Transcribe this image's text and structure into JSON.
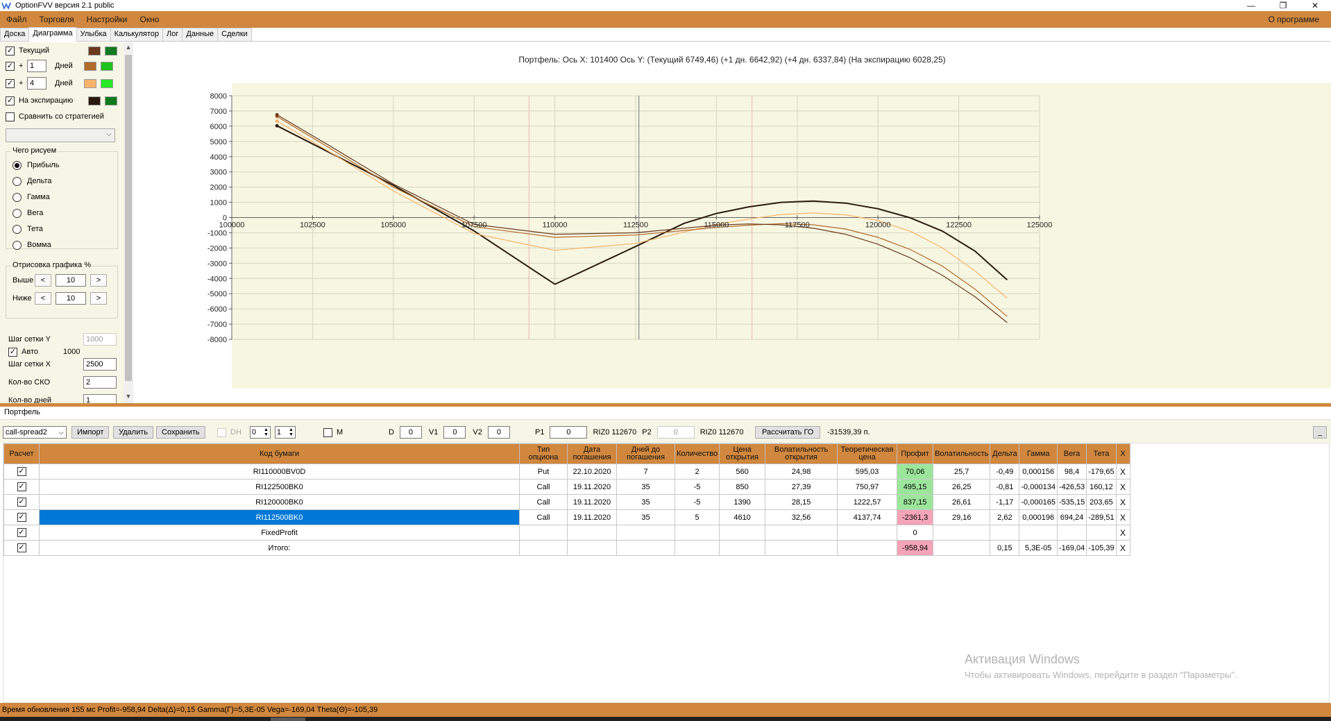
{
  "window": {
    "title": "OptionFVV версия 2.1 public",
    "minimize": "—",
    "restore": "❐",
    "close": "✕"
  },
  "menu": {
    "items": [
      "Файл",
      "Торговля",
      "Настройки",
      "Окно"
    ],
    "about": "О программе"
  },
  "tabs": [
    "Доска",
    "Диаграмма",
    "Улыбка",
    "Калькулятор",
    "Лог",
    "Данные",
    "Сделки"
  ],
  "left_panel": {
    "current_label": "Текущий",
    "plus1_label": "+",
    "plus1_value": "1",
    "days_label": "Дней",
    "plus2_label": "+",
    "plus2_value": "4",
    "days2_label": "Дней",
    "expiry_label": "На экспирацию",
    "compare_label": "Сравнить со стратегией",
    "colors": {
      "current_a": "#6b3a1d",
      "current_b": "#0f7a1e",
      "plus1_a": "#b26a2d",
      "plus1_b": "#1ec21e",
      "plus2_a": "#fbb36b",
      "plus2_b": "#27e827",
      "expiry_a": "#2b1a0e",
      "expiry_b": "#0d7a1a"
    },
    "draw_group": {
      "title": "Чего рисуем",
      "options": [
        "Прибыль",
        "Дельта",
        "Гамма",
        "Вега",
        "Тета",
        "Вомма"
      ],
      "selected": "Прибыль"
    },
    "render_group": {
      "title": "Отрисовка графика %",
      "above_label": "Выше",
      "above_value": "10",
      "below_label": "Ниже",
      "below_value": "10",
      "dec": "<",
      "inc": ">"
    },
    "grid_y_label": "Шаг сетки Y",
    "grid_y_value": "1000",
    "auto_label": "Авто",
    "auto_value": "1000",
    "grid_x_label": "Шаг сетки X",
    "grid_x_value": "2500",
    "sko_label": "Кол-во СКО",
    "sko_value": "2",
    "days_count_label": "Кол-во дней",
    "days_count_value": "1"
  },
  "chart_data": {
    "type": "line",
    "title": "Портфель: Ось X: 101400 Ось Y:  (Текущий 6749,46)  (+1 дн. 6642,92)  (+4 дн. 6337,84)  (На экспирацию 6028,25)",
    "xlim": [
      100000,
      125000
    ],
    "ylim": [
      -8000,
      8000
    ],
    "x_ticks": [
      100000,
      102500,
      105000,
      107500,
      110000,
      112500,
      115000,
      117500,
      120000,
      122500,
      125000
    ],
    "y_ticks": [
      8000,
      7000,
      6000,
      5000,
      4000,
      3000,
      2000,
      1000,
      0,
      -1000,
      -2000,
      -3000,
      -4000,
      -5000,
      -6000,
      -7000,
      -8000
    ],
    "grid": true,
    "cursor_x": 112600,
    "sigma_lines": [
      109200,
      116100
    ],
    "series": [
      {
        "color": "#2b1a0e",
        "x": [
          101400,
          103000,
          105000,
          107500,
          110000,
          112500,
          114000,
          115000,
          116000,
          117000,
          118000,
          119000,
          120000,
          121000,
          122000,
          123000,
          124000
        ],
        "y": [
          6028,
          4300,
          2120,
          -880,
          -4380,
          -1900,
          -380,
          270,
          700,
          1000,
          1080,
          950,
          580,
          -20,
          -900,
          -2200,
          -4100
        ]
      },
      {
        "color": "#fbb36b",
        "x": [
          101400,
          103000,
          105000,
          107500,
          110000,
          112500,
          114000,
          115000,
          116000,
          117000,
          118000,
          119000,
          120000,
          121000,
          122000,
          123000,
          124000
        ],
        "y": [
          6338,
          4350,
          1750,
          -1050,
          -2150,
          -1700,
          -950,
          -450,
          -100,
          200,
          300,
          180,
          -200,
          -900,
          -2000,
          -3500,
          -5300
        ]
      },
      {
        "color": "#b26a2d",
        "x": [
          101400,
          103000,
          105000,
          107500,
          110000,
          112500,
          114000,
          115000,
          116000,
          117000,
          118000,
          119000,
          120000,
          121000,
          122000,
          123000,
          124000
        ],
        "y": [
          6643,
          4600,
          2000,
          -600,
          -1300,
          -1150,
          -850,
          -650,
          -500,
          -400,
          -480,
          -750,
          -1300,
          -2100,
          -3200,
          -4700,
          -6500
        ]
      },
      {
        "color": "#6b3a1d",
        "x": [
          101400,
          103000,
          105000,
          107500,
          110000,
          112500,
          114000,
          115000,
          116000,
          117000,
          118000,
          119000,
          120000,
          121000,
          122000,
          123000,
          124000
        ],
        "y": [
          6749,
          4750,
          2200,
          -450,
          -1100,
          -1000,
          -700,
          -500,
          -420,
          -480,
          -700,
          -1100,
          -1750,
          -2650,
          -3800,
          -5200,
          -6900
        ]
      }
    ]
  },
  "portfolio": {
    "title": "Портфель",
    "strategy": "call-spread2",
    "import": "Импорт",
    "delete": "Удалить",
    "save": "Сохранить",
    "dh_label": "DH",
    "dh_a": "0",
    "dh_b": "1",
    "m_label": "M",
    "d_label": "D",
    "d_value": "0",
    "v1_label": "V1",
    "v1_value": "0",
    "v2_label": "V2",
    "v2_value": "0",
    "p1_label": "P1",
    "p1_value": "0",
    "p1_info": "RIZ0 112670",
    "p2_label": "P2",
    "p2_value": "0",
    "p2_info": "RIZ0 112670",
    "calc_go": "Рассчитать ГО",
    "go_value": "-31539,39 п.",
    "collapse": "_",
    "columns": [
      "Расчет",
      "Код бумаги",
      "Тип опциона",
      "Дата погашения",
      "Дней до погашения",
      "Количество",
      "Цена открытия",
      "Волатильность открытия",
      "Теоретическая цена",
      "Профит",
      "Волатильность",
      "Дельта",
      "Гамма",
      "Вега",
      "Тета",
      "X"
    ],
    "rows": [
      {
        "check": "✓",
        "code": "RI110000BV0D",
        "type": "Put",
        "date": "22.10.2020",
        "days": "7",
        "qty": "2",
        "price": "560",
        "vol_open": "24,98",
        "theo": "595,03",
        "profit": "70,06",
        "vol": "25,7",
        "delta": "-0,49",
        "gamma": "0,000156",
        "vega": "98,4",
        "theta": "-179,65",
        "x": "X"
      },
      {
        "check": "✓",
        "code": "RI122500BK0",
        "type": "Call",
        "date": "19.11.2020",
        "days": "35",
        "qty": "-5",
        "price": "850",
        "vol_open": "27,39",
        "theo": "750,97",
        "profit": "495,15",
        "vol": "26,25",
        "delta": "-0,81",
        "gamma": "-0,000134",
        "vega": "-426,53",
        "theta": "160,12",
        "x": "X"
      },
      {
        "check": "✓",
        "code": "RI120000BK0",
        "type": "Call",
        "date": "19.11.2020",
        "days": "35",
        "qty": "-5",
        "price": "1390",
        "vol_open": "28,15",
        "theo": "1222,57",
        "profit": "837,15",
        "vol": "26,61",
        "delta": "-1,17",
        "gamma": "-0,000165",
        "vega": "-535,15",
        "theta": "203,65",
        "x": "X"
      },
      {
        "check": "✓",
        "code": "RI112500BK0",
        "type": "Call",
        "date": "19.11.2020",
        "days": "35",
        "qty": "5",
        "price": "4610",
        "vol_open": "32,56",
        "theo": "4137,74",
        "profit": "-2361,3",
        "vol": "29,16",
        "delta": "2,62",
        "gamma": "0,000196",
        "vega": "694,24",
        "theta": "-289,51",
        "x": "X"
      },
      {
        "check": "✓",
        "code": "FixedProfit",
        "type": "",
        "date": "",
        "days": "",
        "qty": "",
        "price": "",
        "vol_open": "",
        "theo": "",
        "profit": "0",
        "vol": "",
        "delta": "",
        "gamma": "",
        "vega": "",
        "theta": "",
        "x": "X"
      },
      {
        "check": "✓",
        "code": "Итого:",
        "type": "",
        "date": "",
        "days": "",
        "qty": "",
        "price": "",
        "vol_open": "",
        "theo": "",
        "profit": "-958,94",
        "vol": "",
        "delta": "0,15",
        "gamma": "5,3E-05",
        "vega": "-169,04",
        "theta": "-105,39",
        "x": "X"
      }
    ]
  },
  "watermark": {
    "line1": "Активация Windows",
    "line2": "Чтобы активировать Windows, перейдите в раздел \"Параметры\"."
  },
  "status": "Время обновления 155 мс  Profit=-958,94 Delta(Δ)=0,15 Gamma(Γ)=5,3E-05 Vega=-169,04 Theta(Θ)=-105,39"
}
